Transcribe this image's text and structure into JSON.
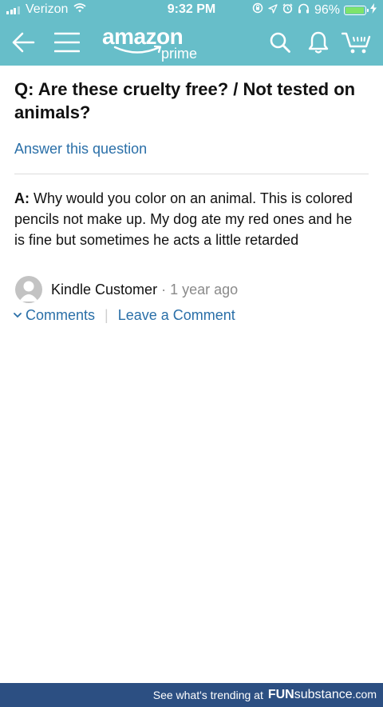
{
  "status_bar": {
    "carrier": "Verizon",
    "time": "9:32 PM",
    "battery_percent": "96%",
    "battery_level": 0.96
  },
  "nav": {
    "logo_wordmark": "amazon",
    "logo_sub": "prime",
    "icons": [
      "back-arrow-icon",
      "hamburger-menu-icon",
      "search-icon",
      "bell-icon",
      "cart-icon"
    ]
  },
  "question": {
    "prefix": "Q:",
    "text": "Are these cruelty free? / Not tested on animals?",
    "answer_link": "Answer this question"
  },
  "answer": {
    "prefix": "A:",
    "text": "Why would you color on an animal. This is colored pencils not make up. My dog ate my red ones and he is fine but sometimes he acts a little retarded",
    "author": "Kindle Customer",
    "separator": "·",
    "time": "1 year ago",
    "comments_label": "Comments",
    "divider": "|",
    "leave_comment_label": "Leave a Comment"
  },
  "footer": {
    "tagline": "See what's trending at",
    "brand_bold": "FUN",
    "brand_rest": "substance",
    "brand_domain": ".com"
  },
  "colors": {
    "header_bg": "#67bec9",
    "link": "#2a6fa8",
    "footer_bg": "#2c4f82",
    "battery_fill": "#7ee36b"
  }
}
